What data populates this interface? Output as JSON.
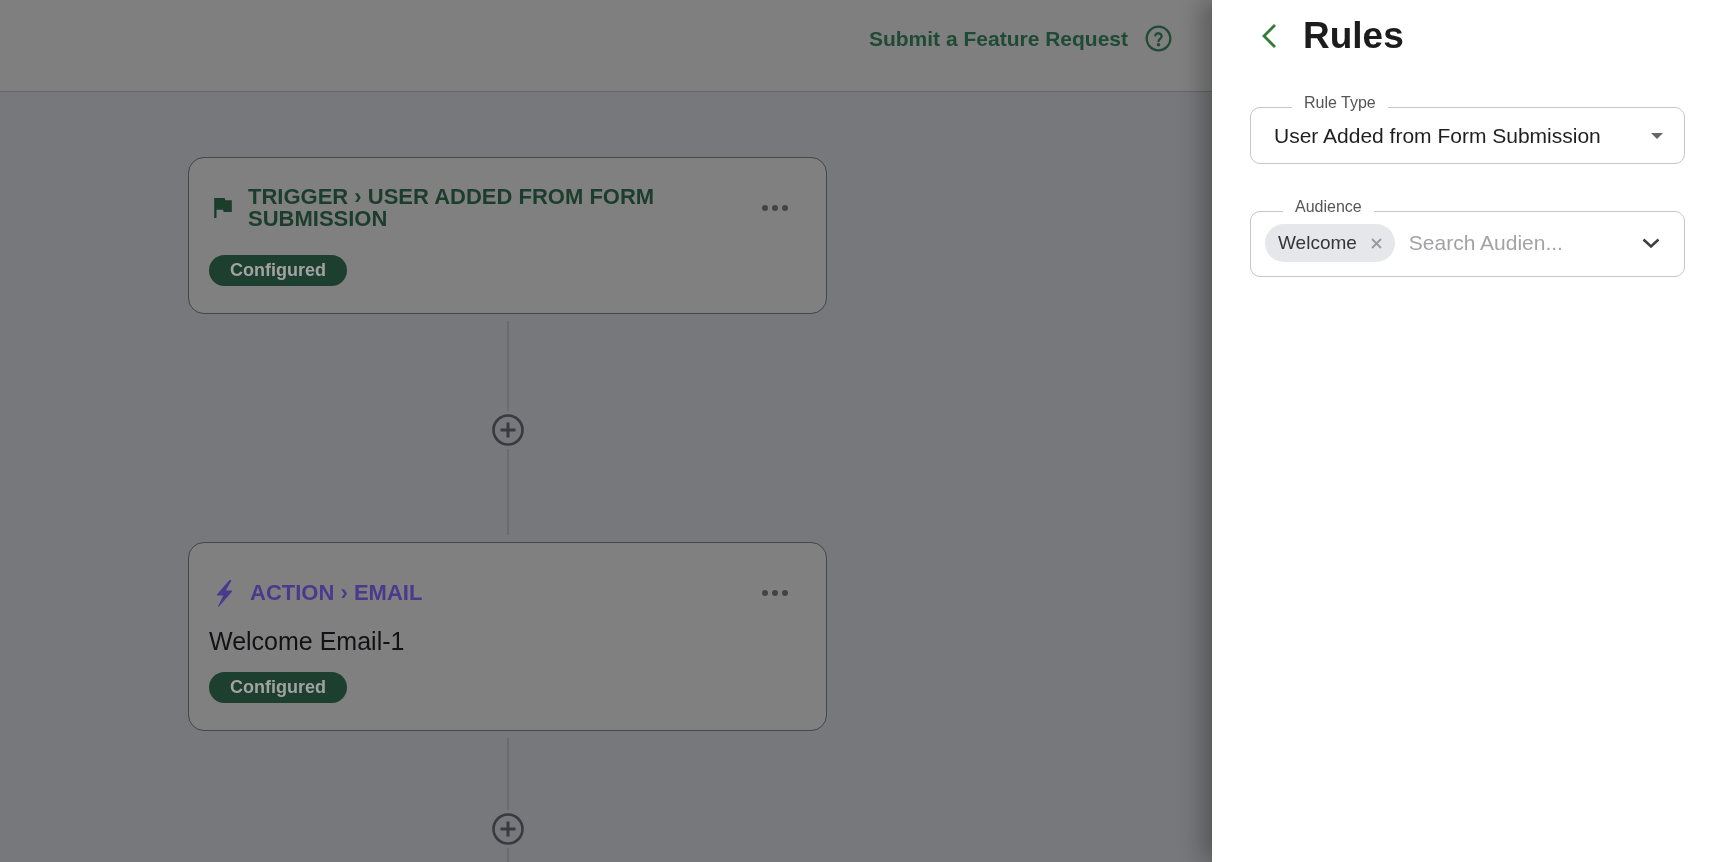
{
  "header": {
    "link": "Submit a Feature Request"
  },
  "steps": [
    {
      "kind": "trigger",
      "heading": "TRIGGER › USER ADDED FROM FORM SUBMISSION",
      "status": "Configured"
    },
    {
      "kind": "action",
      "heading": "ACTION › EMAIL",
      "name": "Welcome Email-1",
      "status": "Configured"
    }
  ],
  "panel": {
    "title": "Rules",
    "fields": [
      {
        "kind": "select",
        "label": "Rule Type",
        "value": "User Added from Form Submission"
      },
      {
        "kind": "multiselect",
        "label": "Audience",
        "chips": [
          "Welcome"
        ],
        "placeholder": "Search Audien..."
      }
    ]
  }
}
